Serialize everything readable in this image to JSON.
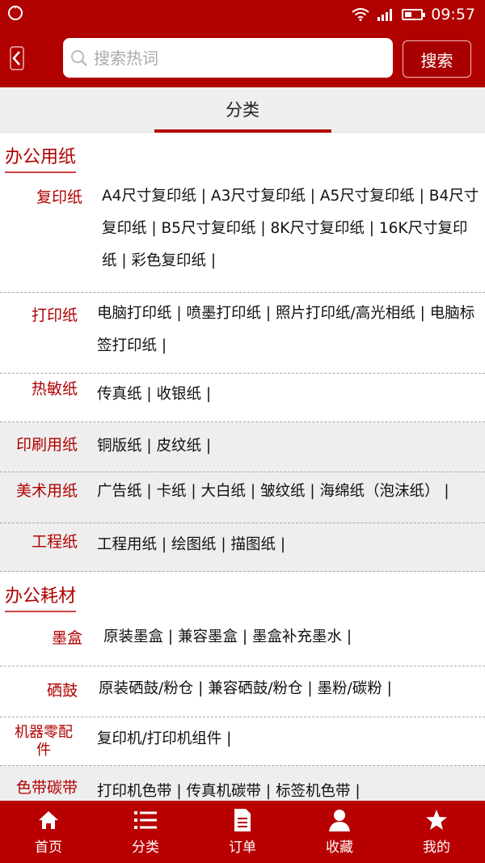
{
  "status_bar": {
    "time": "09:57"
  },
  "search": {
    "placeholder": "搜索热词",
    "button_label": "搜索"
  },
  "tab": {
    "label": "分类"
  },
  "sections": [
    {
      "title": "办公用纸",
      "rows": [
        {
          "label": "复印纸",
          "items": "A4尺寸复印纸 | A3尺寸复印纸 | A5尺寸复印纸 | B4尺寸复印纸 | B5尺寸复印纸 | 8K尺寸复印纸 | 16K尺寸复印纸 | 彩色复印纸 |"
        },
        {
          "label": "打印纸",
          "items": "电脑打印纸 | 喷墨打印纸 | 照片打印纸/高光相纸 | 电脑标签打印纸 |"
        },
        {
          "label": "热敏纸",
          "items": "传真纸 | 收银纸 |"
        },
        {
          "label": "印刷用纸",
          "items": "铜版纸 | 皮纹纸 |"
        },
        {
          "label": "美术用纸",
          "items": "广告纸 | 卡纸 | 大白纸 | 皱纹纸 | 海绵纸（泡沫纸） |"
        },
        {
          "label": "工程纸",
          "items": "工程用纸 | 绘图纸 | 描图纸 |"
        }
      ]
    },
    {
      "title": "办公耗材",
      "rows": [
        {
          "label": "墨盒",
          "items": "原装墨盒 | 兼容墨盒 | 墨盒补充墨水 |"
        },
        {
          "label": "硒鼓",
          "items": "原装硒鼓/粉仓 | 兼容硒鼓/粉仓 | 墨粉/碳粉 |"
        },
        {
          "label": "机器零配件",
          "items": "复印机/打印机组件 |"
        },
        {
          "label": "色带碳带",
          "items": "打印机色带 | 传真机碳带 | 标签机色带 |"
        }
      ]
    }
  ],
  "bottom_nav": [
    {
      "label": "首页",
      "icon": "home-icon"
    },
    {
      "label": "分类",
      "icon": "list-icon"
    },
    {
      "label": "订单",
      "icon": "document-icon"
    },
    {
      "label": "收藏",
      "icon": "user-icon"
    },
    {
      "label": "我的",
      "icon": "star-icon"
    }
  ],
  "colors": {
    "brand": "#b00000",
    "label_text": "#b00000",
    "row_gray": "#eeeeee"
  }
}
